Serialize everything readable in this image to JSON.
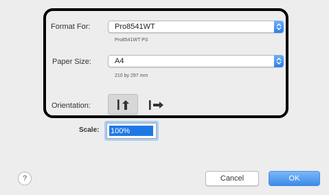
{
  "format_for": {
    "label": "Format For:",
    "value": "Pro8541WT",
    "subtitle": "Pro8541WT PS"
  },
  "paper_size": {
    "label": "Paper Size:",
    "value": "A4",
    "subtitle": "210 by 297 mm"
  },
  "orientation": {
    "label": "Orientation:",
    "options": [
      {
        "name": "portrait",
        "selected": true
      },
      {
        "name": "landscape",
        "selected": false
      }
    ]
  },
  "scale": {
    "label": "Scale:",
    "value": "100%"
  },
  "buttons": {
    "help": "?",
    "cancel": "Cancel",
    "ok": "OK"
  },
  "colors": {
    "accent": "#2f7ee6",
    "highlight_frame": "#000000",
    "selection": "#1e78e6"
  }
}
